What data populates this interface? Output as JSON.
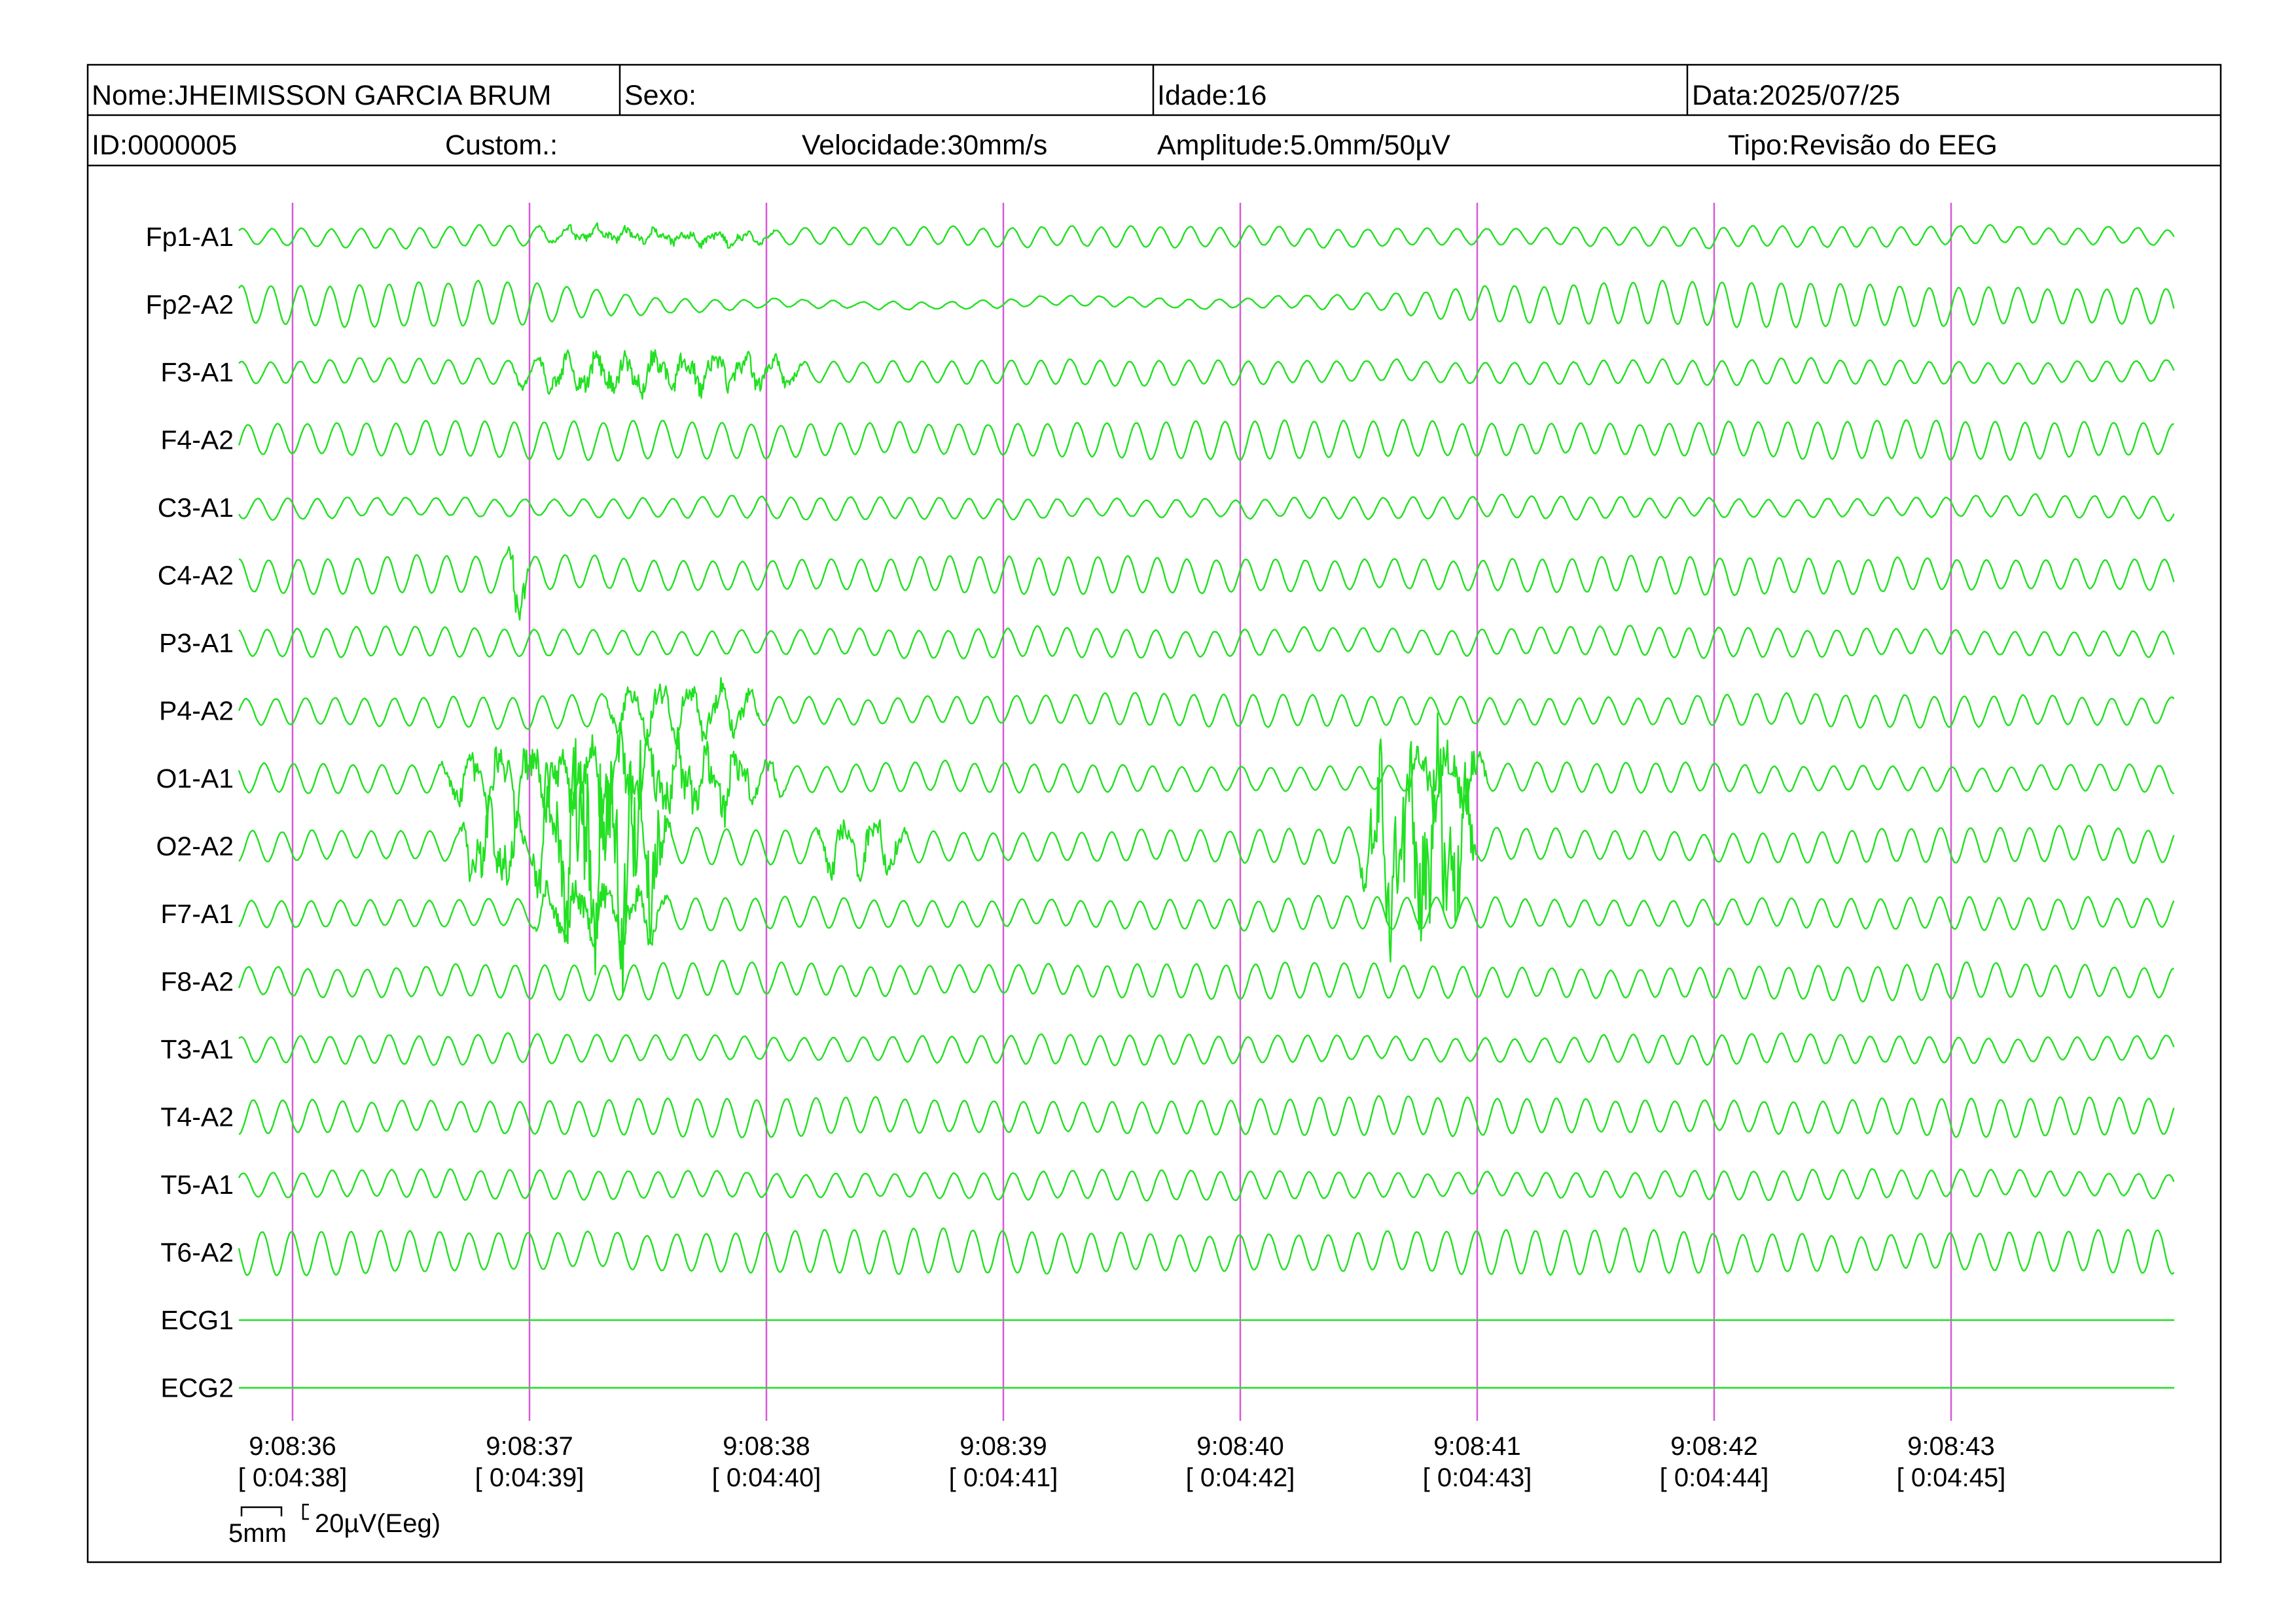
{
  "header": {
    "nome": "Nome:JHEIMISSON GARCIA BRUM",
    "sexo": "Sexo:",
    "idade": "Idade:16",
    "data": "Data:2025/07/25",
    "id": "ID:0000005",
    "custom": "Custom.:",
    "velocidade": "Velocidade:30mm/s",
    "amplitude": "Amplitude:5.0mm/50µV",
    "tipo": "Tipo:Revisão do EEG"
  },
  "scale_bar": {
    "time_label": "5mm",
    "amp_label": "20µV(Eeg)"
  },
  "colors": {
    "trace": "#22e022",
    "marker": "#d65ad6",
    "frame": "#000000",
    "background": "#ffffff"
  },
  "chart_data": {
    "type": "line",
    "title": "",
    "xlabel": "",
    "ylabel": "",
    "x_range_s": [
      -0.23,
      8.23
    ],
    "grid": false,
    "legend": "none",
    "channels": [
      {
        "name": "Fp1-A1",
        "freq_hz": 8,
        "base_amp": 14,
        "events": [
          {
            "t": [
              1.0,
              2.1
            ],
            "amp": 7,
            "chaos": 6
          }
        ]
      },
      {
        "name": "Fp2-A2",
        "freq_hz": 8,
        "base_amp": 30,
        "events": [
          {
            "t": [
              1.0,
              5.0
            ],
            "amp": 6,
            "chaos": 0
          }
        ]
      },
      {
        "name": "F3-A1",
        "freq_hz": 8,
        "base_amp": 17,
        "events": [
          {
            "t": [
              0.9,
              2.2
            ],
            "amp": 22,
            "chaos": 14
          }
        ]
      },
      {
        "name": "F4-A2",
        "freq_hz": 8,
        "base_amp": 26,
        "events": []
      },
      {
        "name": "C3-A1",
        "freq_hz": 8,
        "base_amp": 15,
        "events": []
      },
      {
        "name": "C4-A2",
        "freq_hz": 8,
        "base_amp": 25,
        "events": [
          {
            "t": [
              0.9,
              1.0
            ],
            "amp": 50,
            "chaos": 25
          }
        ]
      },
      {
        "name": "P3-A1",
        "freq_hz": 8,
        "base_amp": 20,
        "events": []
      },
      {
        "name": "P4-A2",
        "freq_hz": 8,
        "base_amp": 22,
        "events": [
          {
            "t": [
              1.3,
              2.0
            ],
            "amp": 30,
            "chaos": 16
          }
        ]
      },
      {
        "name": "O1-A1",
        "freq_hz": 8,
        "base_amp": 20,
        "events": [
          {
            "t": [
              0.6,
              2.1
            ],
            "amp": 40,
            "chaos": 30
          },
          {
            "t": [
              4.7,
              5.05
            ],
            "amp": 38,
            "chaos": 28
          }
        ]
      },
      {
        "name": "O2-A2",
        "freq_hz": 8,
        "base_amp": 24,
        "events": [
          {
            "t": [
              0.7,
              1.0
            ],
            "amp": 40,
            "chaos": 30
          },
          {
            "t": [
              1.0,
              1.6
            ],
            "amp": 80,
            "chaos": 90
          },
          {
            "t": [
              2.2,
              2.6
            ],
            "amp": 36,
            "chaos": 18
          },
          {
            "t": [
              4.5,
              5.0
            ],
            "amp": 80,
            "chaos": 85
          }
        ]
      },
      {
        "name": "F7-A1",
        "freq_hz": 8,
        "base_amp": 22,
        "events": [
          {
            "t": [
              1.0,
              1.6
            ],
            "amp": 34,
            "chaos": 20
          }
        ]
      },
      {
        "name": "F8-A2",
        "freq_hz": 8,
        "base_amp": 24,
        "events": []
      },
      {
        "name": "T3-A1",
        "freq_hz": 8,
        "base_amp": 20,
        "events": []
      },
      {
        "name": "T4-A2",
        "freq_hz": 8,
        "base_amp": 26,
        "events": []
      },
      {
        "name": "T5-A1",
        "freq_hz": 8,
        "base_amp": 20,
        "events": []
      },
      {
        "name": "T6-A2",
        "freq_hz": 8,
        "base_amp": 30,
        "events": []
      },
      {
        "name": "ECG1",
        "freq_hz": 0,
        "base_amp": 0,
        "events": []
      },
      {
        "name": "ECG2",
        "freq_hz": 0,
        "base_amp": 0,
        "events": []
      }
    ],
    "time_markers": [
      {
        "t": 0,
        "clock": "9:08:36",
        "elapsed": "[ 0:04:38]"
      },
      {
        "t": 1,
        "clock": "9:08:37",
        "elapsed": "[ 0:04:39]"
      },
      {
        "t": 2,
        "clock": "9:08:38",
        "elapsed": "[ 0:04:40]"
      },
      {
        "t": 3,
        "clock": "9:08:39",
        "elapsed": "[ 0:04:41]"
      },
      {
        "t": 4,
        "clock": "9:08:40",
        "elapsed": "[ 0:04:42]"
      },
      {
        "t": 5,
        "clock": "9:08:41",
        "elapsed": "[ 0:04:43]"
      },
      {
        "t": 6,
        "clock": "9:08:42",
        "elapsed": "[ 0:04:44]"
      },
      {
        "t": 7,
        "clock": "9:08:43",
        "elapsed": "[ 0:04:45]"
      }
    ]
  }
}
